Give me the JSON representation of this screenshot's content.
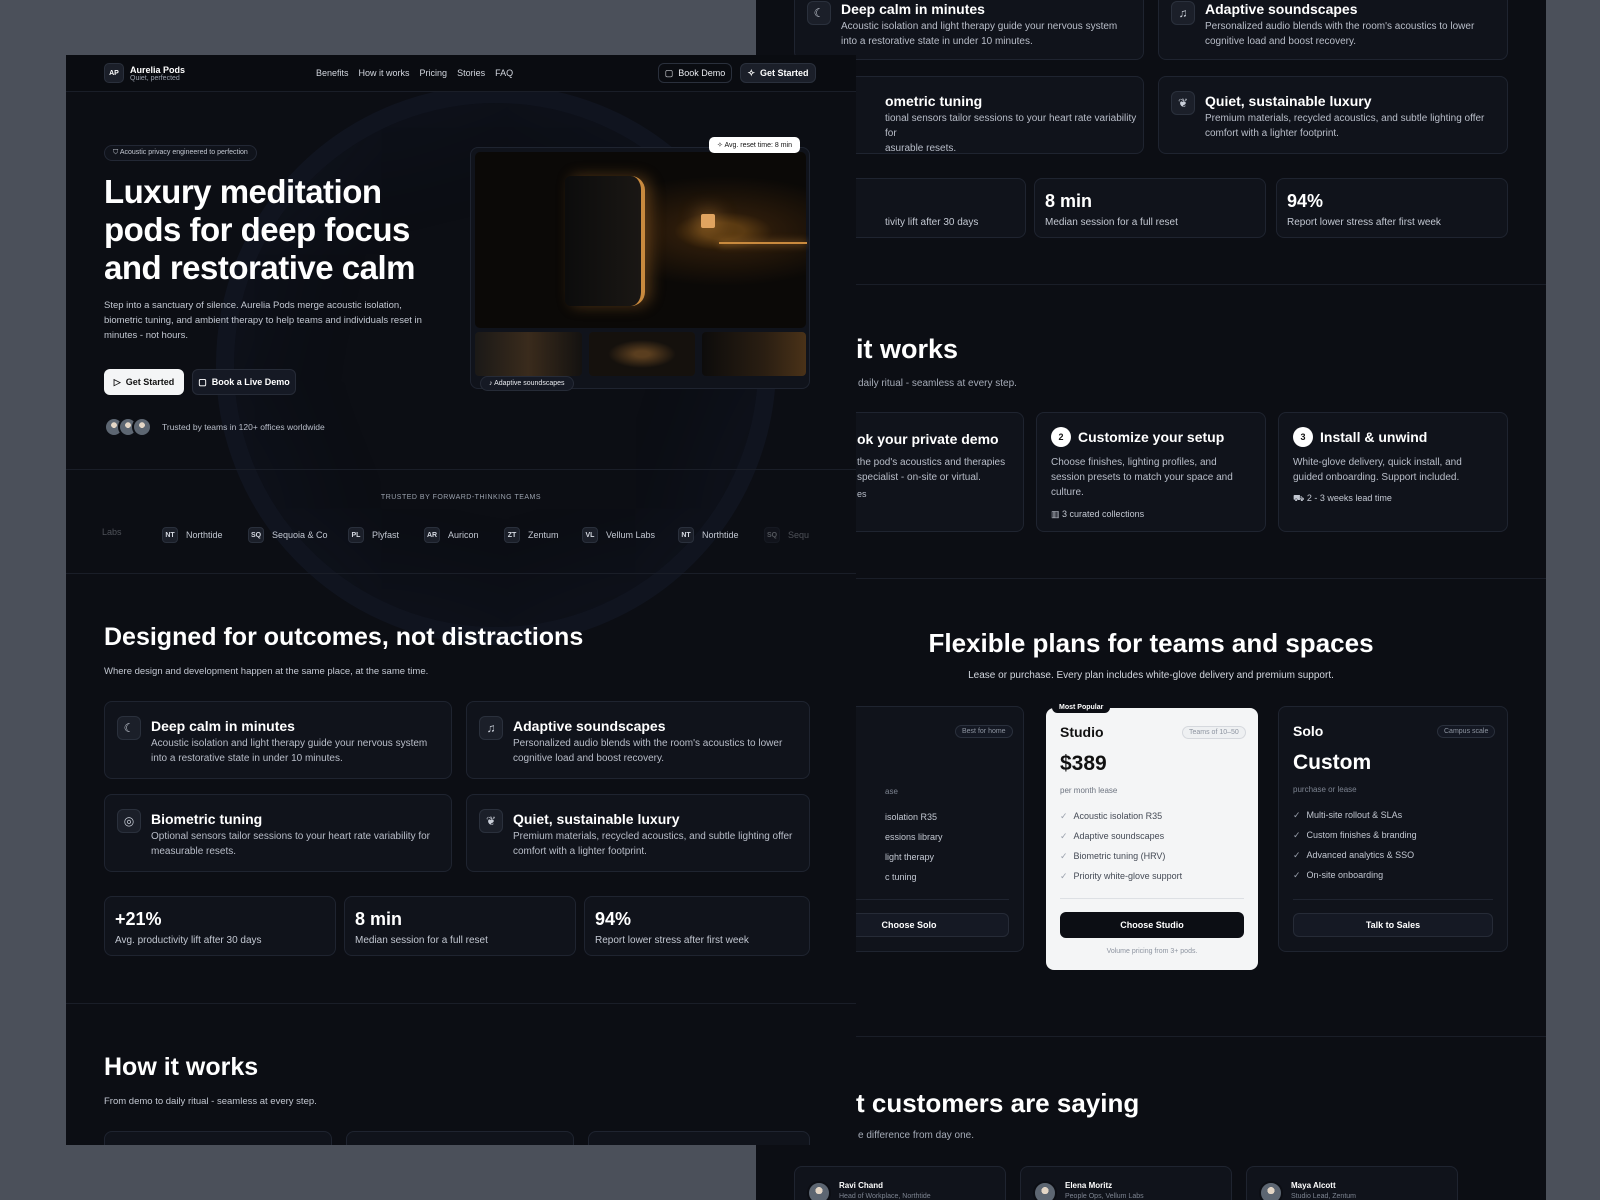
{
  "brand": {
    "initials": "AP",
    "name": "Aurelia Pods",
    "tagline": "Quiet, perfected"
  },
  "nav": {
    "items": [
      "Benefits",
      "How it works",
      "Pricing",
      "Stories",
      "FAQ"
    ],
    "book_demo": "Book Demo",
    "get_started": "Get Started"
  },
  "hero": {
    "badge": "Acoustic privacy engineered to perfection",
    "title_lines": [
      "Luxury meditation",
      "pods for deep focus",
      "and restorative calm"
    ],
    "subtitle_lines": [
      "Step into a sanctuary of silence. Aurelia Pods merge acoustic isolation,",
      "biometric tuning, and ambient therapy to help teams and individuals reset in",
      "minutes - not hours."
    ],
    "cta_primary": "Get Started",
    "cta_secondary": "Book a Live Demo",
    "trust": "Trusted by teams in 120+ offices worldwide",
    "reset_chip": "Avg. reset time: 8 min",
    "soundscape_chip": "Adaptive soundscapes"
  },
  "logos": {
    "heading": "TRUSTED BY FORWARD-THINKING TEAMS",
    "items": [
      {
        "abbr": "",
        "name": "Labs"
      },
      {
        "abbr": "NT",
        "name": "Northtide"
      },
      {
        "abbr": "SQ",
        "name": "Sequoia & Co"
      },
      {
        "abbr": "PL",
        "name": "Plyfast"
      },
      {
        "abbr": "AR",
        "name": "Auricon"
      },
      {
        "abbr": "ZT",
        "name": "Zentum"
      },
      {
        "abbr": "VL",
        "name": "Vellum Labs"
      },
      {
        "abbr": "NT",
        "name": "Northtide"
      },
      {
        "abbr": "SQ",
        "name": "Sequ"
      }
    ]
  },
  "outcomes": {
    "title": "Designed for outcomes, not distractions",
    "subtitle": "Where design and development happen at the same place, at the same time.",
    "features": [
      {
        "icon": "moon-icon",
        "title": "Deep calm in minutes",
        "lines": [
          "Acoustic isolation and light therapy guide your nervous system",
          "into a restorative state in under 10 minutes."
        ]
      },
      {
        "icon": "headphones-icon",
        "title": "Adaptive soundscapes",
        "lines": [
          "Personalized audio blends with the room's acoustics to lower",
          "cognitive load and boost recovery."
        ]
      },
      {
        "icon": "fingerprint-icon",
        "title": "Biometric tuning",
        "lines": [
          "Optional sensors tailor sessions to your heart rate variability for",
          "measurable resets."
        ]
      },
      {
        "icon": "leaf-icon",
        "title": "Quiet, sustainable luxury",
        "lines": [
          "Premium materials, recycled acoustics, and subtle lighting offer",
          "comfort with a lighter footprint."
        ]
      }
    ],
    "stats": [
      {
        "value": "+21%",
        "label": "Avg. productivity lift after 30 days"
      },
      {
        "value": "8 min",
        "label": "Median session for a full reset"
      },
      {
        "value": "94%",
        "label": "Report lower stress after first week"
      }
    ]
  },
  "how": {
    "title": "How it works",
    "subtitle": "From demo to daily ritual - seamless at every step.",
    "right_title": "it works",
    "right_subtitle": "daily ritual - seamless at every step.",
    "steps": [
      {
        "n": "1",
        "title": "ok your private demo",
        "lines": [
          "the pod's acoustics and therapies",
          "specialist - on-site or virtual."
        ],
        "meta": "es"
      },
      {
        "n": "2",
        "title": "Customize your setup",
        "lines": [
          "Choose finishes, lighting profiles, and",
          "session presets to match your space and",
          "culture."
        ],
        "meta": "3 curated collections"
      },
      {
        "n": "3",
        "title": "Install & unwind",
        "lines": [
          "White-glove delivery, quick install, and",
          "guided onboarding. Support included."
        ],
        "meta": "2 - 3 weeks lead time"
      }
    ]
  },
  "right_features": {
    "top": [
      {
        "title": "Deep calm in minutes",
        "lines": [
          "Acoustic isolation and light therapy guide your nervous system",
          "into a restorative state in under 10 minutes."
        ]
      },
      {
        "title": "Adaptive soundscapes",
        "lines": [
          "Personalized audio blends with the room's acoustics to lower",
          "cognitive load and boost recovery."
        ]
      },
      {
        "title": "ometric tuning",
        "lines": [
          "tional sensors tailor sessions to your heart rate variability for",
          "asurable resets."
        ]
      },
      {
        "title": "Quiet, sustainable luxury",
        "lines": [
          "Premium materials, recycled acoustics, and subtle lighting offer",
          "comfort with a lighter footprint."
        ]
      }
    ],
    "stats": [
      {
        "value": "",
        "label": "tivity lift after 30 days"
      },
      {
        "value": "8 min",
        "label": "Median session for a full reset"
      },
      {
        "value": "94%",
        "label": "Report lower stress after first week"
      }
    ]
  },
  "pricing": {
    "title": "Flexible plans for teams and spaces",
    "subtitle": "Lease or purchase. Every plan includes white-glove delivery and premium support.",
    "plans": [
      {
        "tag": "Best for home",
        "price": "",
        "period": "ase",
        "features": [
          "isolation R35",
          "essions library",
          "light therapy",
          "c tuning"
        ],
        "cta": "Choose Solo"
      },
      {
        "badge": "Most Popular",
        "name": "Studio",
        "tag": "Teams of 10–50",
        "price": "$389",
        "period": "per month lease",
        "features": [
          "Acoustic isolation R35",
          "Adaptive soundscapes",
          "Biometric tuning (HRV)",
          "Priority white-glove support"
        ],
        "cta": "Choose Studio",
        "note": "Volume pricing from 3+ pods."
      },
      {
        "name": "Solo",
        "tag": "Campus scale",
        "price": "Custom",
        "period": "purchase or lease",
        "features": [
          "Multi-site rollout & SLAs",
          "Custom finishes & branding",
          "Advanced analytics & SSO",
          "On-site onboarding"
        ],
        "cta": "Talk to Sales"
      }
    ]
  },
  "testimonials": {
    "title": "t customers are saying",
    "subtitle": "e difference from day one.",
    "people": [
      {
        "name": "Ravi Chand",
        "role": "Head of Workplace, Northtide"
      },
      {
        "name": "Elena Moritz",
        "role": "People Ops, Vellum Labs"
      },
      {
        "name": "Maya Alcott",
        "role": "Studio Lead, Zentum"
      }
    ]
  },
  "colors": {
    "page": "#0c0e14",
    "card": "#10131b",
    "backdrop": "#4b505a",
    "accent": "#ffffff"
  }
}
